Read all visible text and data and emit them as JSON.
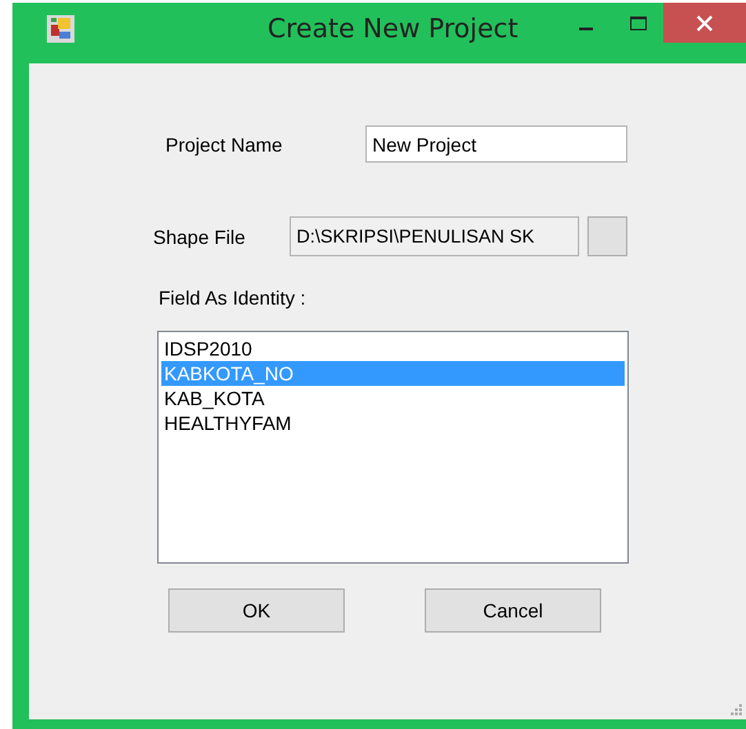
{
  "window": {
    "title": "Create New Project"
  },
  "project_name": {
    "label": "Project Name",
    "value": "New Project"
  },
  "shape_file": {
    "label": "Shape File",
    "value": "D:\\SKRIPSI\\PENULISAN SK"
  },
  "identity": {
    "label": "Field As Identity :",
    "items": [
      {
        "text": "IDSP2010",
        "selected": false
      },
      {
        "text": "KABKOTA_NO",
        "selected": true
      },
      {
        "text": "KAB_KOTA",
        "selected": false
      },
      {
        "text": "HEALTHYFAM",
        "selected": false
      }
    ]
  },
  "buttons": [
    "OK",
    "Cancel"
  ]
}
